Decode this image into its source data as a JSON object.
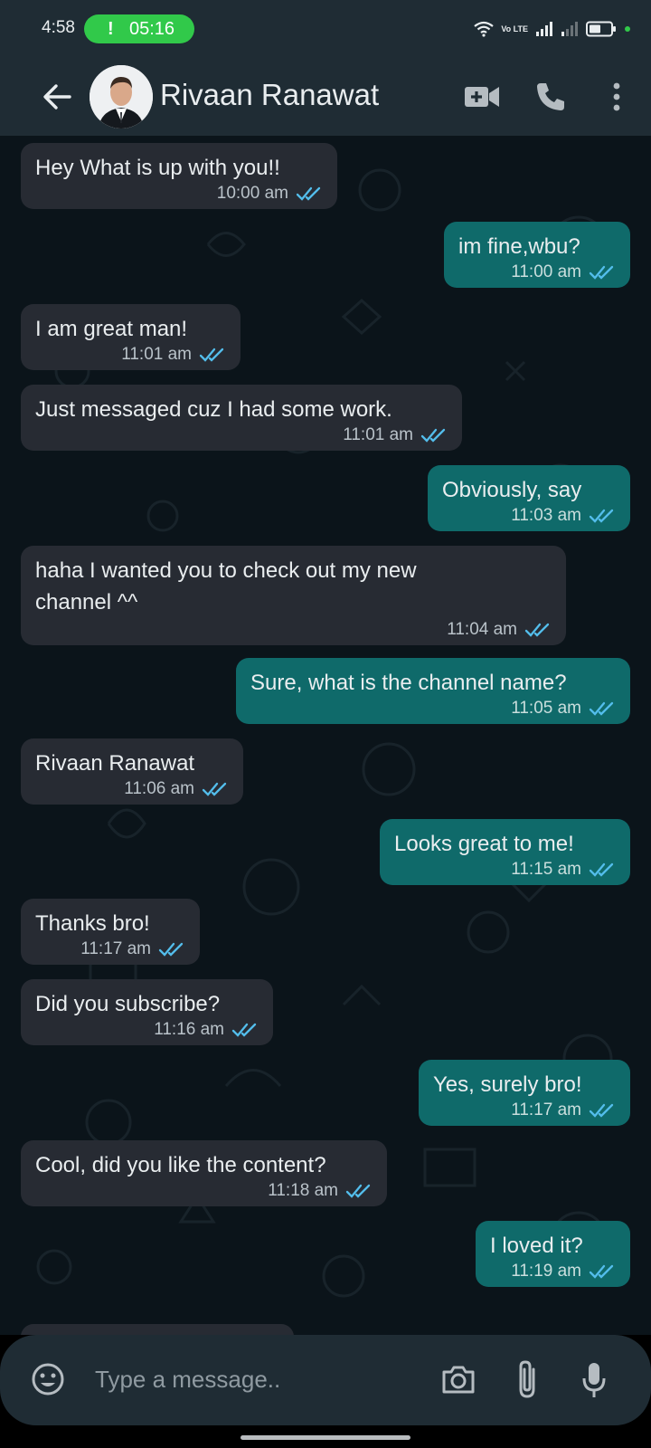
{
  "status_bar": {
    "time": "4:58",
    "call_indicator": "!",
    "call_time": "05:16",
    "network_label": "Vo LTE",
    "icons": [
      "wifi-icon",
      "volte-icon",
      "signal-icon",
      "signal-icon",
      "battery-icon",
      "dot-icon"
    ]
  },
  "header": {
    "contact_name": "Rivaan Ranawat",
    "icons": [
      "back-arrow-icon",
      "avatar",
      "video-call-icon",
      "phone-icon",
      "more-vert-icon"
    ]
  },
  "messages": [
    {
      "dir": "in",
      "text": "Hey What is up with you!!",
      "time": "10:00 am"
    },
    {
      "dir": "out",
      "text": "im fine,wbu?",
      "time": "11:00 am"
    },
    {
      "dir": "in",
      "text": "I am great man!",
      "time": "11:01 am"
    },
    {
      "dir": "in",
      "text": "Just messaged cuz I had some work.",
      "time": "11:01 am"
    },
    {
      "dir": "out",
      "text": "Obviously, say",
      "time": "11:03 am"
    },
    {
      "dir": "in",
      "text": "haha I wanted you to check out my new\nchannel ^^",
      "time": "11:04 am"
    },
    {
      "dir": "out",
      "text": "Sure, what is the channel name?",
      "time": "11:05 am"
    },
    {
      "dir": "in",
      "text": "Rivaan Ranawat",
      "time": "11:06 am"
    },
    {
      "dir": "out",
      "text": "Looks great to me!",
      "time": "11:15 am"
    },
    {
      "dir": "in",
      "text": "Thanks bro!",
      "time": "11:17 am"
    },
    {
      "dir": "in",
      "text": "Did you subscribe?",
      "time": "11:16 am"
    },
    {
      "dir": "out",
      "text": "Yes, surely bro!",
      "time": "11:17 am"
    },
    {
      "dir": "in",
      "text": "Cool, did you like the content?",
      "time": "11:18 am"
    },
    {
      "dir": "out",
      "text": "I loved it?",
      "time": "11:19 am"
    }
  ],
  "input": {
    "placeholder": "Type a message..",
    "value": "",
    "icons": [
      "emoji-icon",
      "camera-icon",
      "attach-icon",
      "mic-icon"
    ]
  },
  "colors": {
    "app_bar": "#1f2c34",
    "chat_bg": "#0b141a",
    "incoming_bubble": "#272b33",
    "outgoing_bubble": "#0f6a6a",
    "read_ticks": "#53bdeb",
    "call_pill": "#31c94a"
  }
}
